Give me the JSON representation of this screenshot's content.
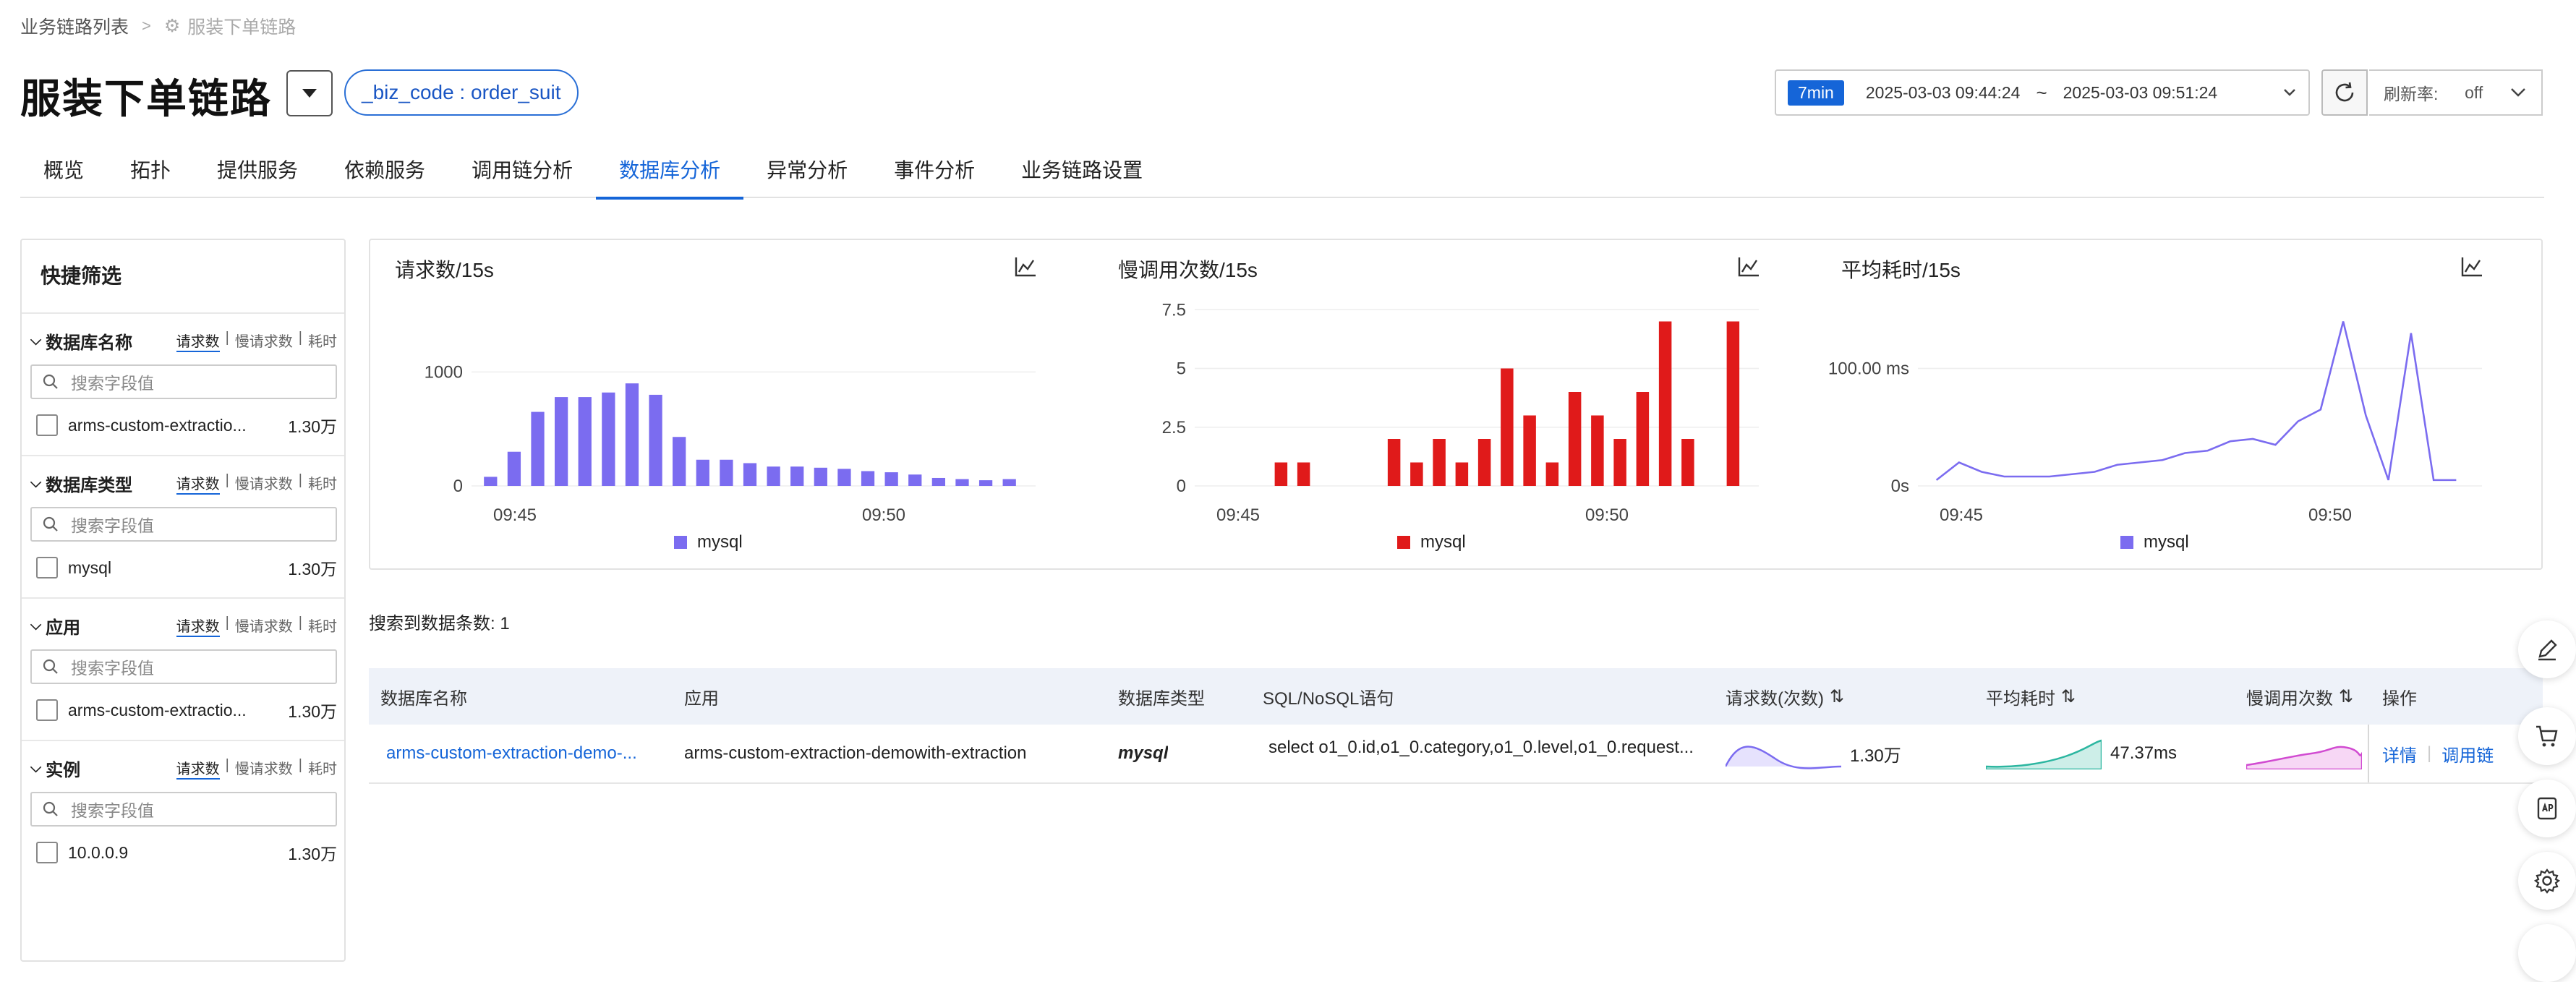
{
  "breadcrumb": {
    "root": "业务链路列表",
    "current": "服装下单链路"
  },
  "page": {
    "title": "服装下单链路",
    "tag": "_biz_code : order_suit"
  },
  "time": {
    "badge": "7min",
    "start": "2025-03-03 09:44:24",
    "sep": "~",
    "end": "2025-03-03 09:51:24",
    "rate_label": "刷新率:",
    "rate_value": "off"
  },
  "tabs": [
    "概览",
    "拓扑",
    "提供服务",
    "依赖服务",
    "调用链分析",
    "数据库分析",
    "异常分析",
    "事件分析",
    "业务链路设置"
  ],
  "active_tab": 5,
  "sidebar": {
    "title": "快捷筛选",
    "modes": [
      "请求数",
      "慢请求数",
      "耗时"
    ],
    "search_placeholder": "搜索字段值",
    "sections": [
      {
        "label": "数据库名称",
        "item": "arms-custom-extractio...",
        "count": "1.30万"
      },
      {
        "label": "数据库类型",
        "item": "mysql",
        "count": "1.30万"
      },
      {
        "label": "应用",
        "item": "arms-custom-extractio...",
        "count": "1.30万"
      },
      {
        "label": "实例",
        "item": "10.0.0.9",
        "count": "1.30万"
      }
    ]
  },
  "chart_data": [
    {
      "type": "bar",
      "title": "请求数/15s",
      "x_ticks": [
        "09:45",
        "09:50"
      ],
      "y_ticks": [
        "0",
        "1000"
      ],
      "ylim": [
        0,
        1650
      ],
      "color": "#7b6cf0",
      "series": [
        {
          "name": "mysql",
          "values": [
            80,
            300,
            650,
            780,
            780,
            820,
            900,
            800,
            430,
            230,
            230,
            200,
            170,
            170,
            160,
            150,
            130,
            120,
            100,
            70,
            60,
            50,
            60
          ]
        }
      ]
    },
    {
      "type": "bar",
      "title": "慢调用次数/15s",
      "x_ticks": [
        "09:45",
        "09:50"
      ],
      "y_ticks": [
        "0",
        "2.5",
        "5",
        "7.5"
      ],
      "ylim": [
        0,
        8
      ],
      "color": "#e01a1a",
      "series": [
        {
          "name": "mysql",
          "values": [
            0,
            0,
            0,
            1,
            1,
            0,
            0,
            0,
            2,
            1,
            2,
            1,
            2,
            5,
            3,
            1,
            4,
            3,
            2,
            4,
            7,
            2,
            0,
            7
          ]
        }
      ]
    },
    {
      "type": "line",
      "title": "平均耗时/15s",
      "x_ticks": [
        "09:45",
        "09:50"
      ],
      "y_ticks": [
        "0s",
        "100.00 ms"
      ],
      "ylim": [
        0,
        160
      ],
      "color": "#7b6cf0",
      "series": [
        {
          "name": "mysql",
          "values": [
            5,
            20,
            12,
            8,
            8,
            8,
            10,
            12,
            18,
            20,
            22,
            28,
            30,
            38,
            40,
            35,
            55,
            65,
            140,
            60,
            5,
            130,
            5,
            5
          ]
        }
      ]
    }
  ],
  "table": {
    "found_label": "搜索到数据条数:",
    "found_count": "1",
    "headers": [
      "数据库名称",
      "应用",
      "数据库类型",
      "SQL/NoSQL语句",
      "请求数(次数)",
      "平均耗时",
      "慢调用次数",
      "操作"
    ],
    "row": {
      "db": "arms-custom-extraction-demo-...",
      "app": "arms-custom-extraction-demowith-extraction",
      "type": "mysql",
      "sql": "select o1_0.id,o1_0.category,o1_0.level,o1_0.request...",
      "requests": "1.30万",
      "avg": "47.37ms",
      "detail": "详情",
      "trace": "调用链"
    }
  },
  "colors": {
    "accent": "#1565d8",
    "req": "#7b6cf0",
    "slow": "#e01a1a",
    "avg": "#2bb6a0",
    "slowspark": "#d14bd1"
  }
}
